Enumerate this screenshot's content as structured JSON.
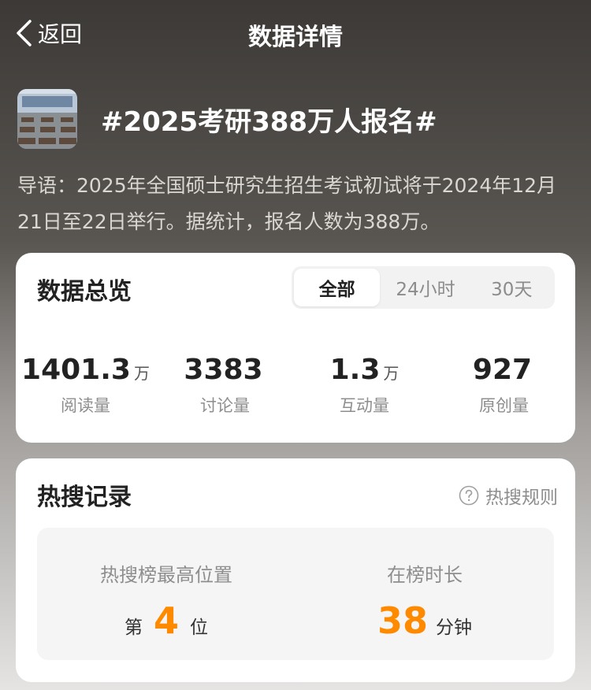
{
  "nav": {
    "back_label": "返回",
    "title": "数据详情"
  },
  "topic": {
    "title": "#2025考研388万人报名#",
    "intro": "导语：2025年全国硕士研究生招生考试初试将于2024年12月21日至22日举行。据统计，报名人数为388万。"
  },
  "overview": {
    "title": "数据总览",
    "tabs": [
      "全部",
      "24小时",
      "30天"
    ],
    "active_tab": "全部",
    "stats": [
      {
        "value": "1401.3",
        "unit": "万",
        "label": "阅读量"
      },
      {
        "value": "3383",
        "unit": "",
        "label": "讨论量"
      },
      {
        "value": "1.3",
        "unit": "万",
        "label": "互动量"
      },
      {
        "value": "927",
        "unit": "",
        "label": "原创量"
      }
    ]
  },
  "hot": {
    "title": "热搜记录",
    "rules_label": "热搜规则",
    "highest": {
      "label": "热搜榜最高位置",
      "prefix": "第",
      "value": "4",
      "suffix": "位"
    },
    "duration": {
      "label": "在榜时长",
      "value": "38",
      "suffix": "分钟"
    }
  },
  "colors": {
    "accent": "#ff8a00",
    "card_bg": "#ffffff",
    "muted_text": "#8e8e8e"
  },
  "icons": {
    "back": "chevron-left-icon",
    "rules": "question-circle-icon"
  }
}
